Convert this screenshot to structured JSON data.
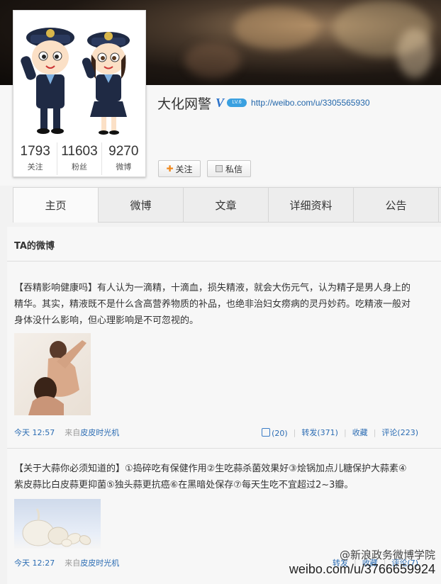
{
  "profile": {
    "name": "大化网警",
    "verified_badge": "V",
    "level_badge": "LV.6",
    "url": "http://weibo.com/u/3305565930",
    "stats": [
      {
        "value": "1793",
        "label": "关注"
      },
      {
        "value": "11603",
        "label": "粉丝"
      },
      {
        "value": "9270",
        "label": "微博"
      }
    ],
    "follow_button": "关注",
    "message_button": "私信"
  },
  "tabs": [
    "主页",
    "微博",
    "文章",
    "详细资料",
    "公告"
  ],
  "feed": {
    "section_title": "TA的微博",
    "posts": [
      {
        "text": "【吞精影响健康吗】有人认为一滴精，十滴血，损失精液，就会大伤元气，认为精子是男人身上的精华。其实，精液既不是什么含高营养物质的补品，也绝非治妇女痨病的灵丹妙药。吃精液一般对身体没什么影响，但心理影响是不可忽视的。",
        "time": "今天 12:57",
        "source_prefix": "来自",
        "source": "皮皮时光机",
        "likes": "(20)",
        "repost": "转发(371)",
        "favorite": "收藏",
        "comment": "评论(223)"
      },
      {
        "text": "【关于大蒜你必须知道的】①捣碎吃有保健作用②生吃蒜杀菌效果好③烩锅加点儿糖保护大蒜素④紫皮蒜比白皮蒜更抑菌⑤独头蒜更抗癌⑥在黑暗处保存⑦每天生吃不宜超过2~3瓣。",
        "time": "今天 12:27",
        "source_prefix": "来自",
        "source": "皮皮时光机",
        "repost": "转发",
        "favorite": "收藏",
        "comment": "评论(7)"
      }
    ]
  },
  "watermark": {
    "line1": "@新浪政务微博学院",
    "line2": "weibo.com/u/3766659924"
  },
  "colors": {
    "link": "#2b6cb3",
    "accent": "#f0891e"
  }
}
